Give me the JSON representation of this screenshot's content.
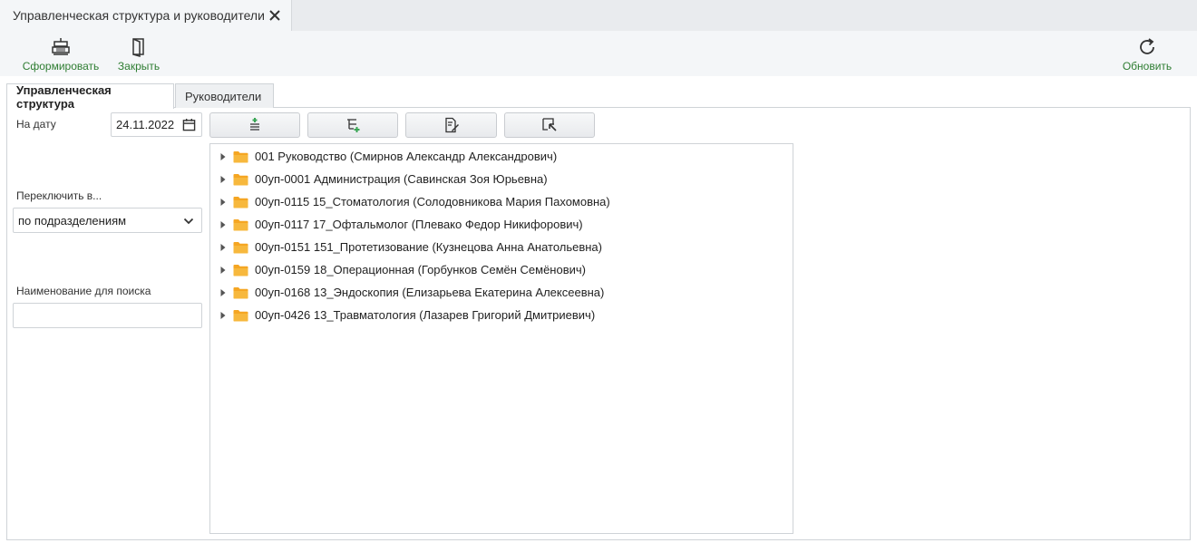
{
  "window_tab": {
    "title": "Управленческая структура и руководители"
  },
  "toolbar": {
    "form_label": "Сформировать",
    "close_label": "Закрыть",
    "refresh_label": "Обновить"
  },
  "tabs": [
    {
      "label": "Управленческая структура",
      "active": true
    },
    {
      "label": "Руководители",
      "active": false
    }
  ],
  "filters": {
    "date_label": "На дату",
    "date_value": "24.11.2022",
    "switch_label": "Переключить в...",
    "switch_value": "по подразделениям",
    "search_label": "Наименование для поиска",
    "search_value": ""
  },
  "tree": {
    "items": [
      {
        "label": "001 Руководство (Смирнов Александр Александрович)"
      },
      {
        "label": "00уп-0001 Администрация (Савинская Зоя Юрьевна)"
      },
      {
        "label": "00уп-0115 15_Стоматология (Солодовникова Мария Пахомовна)"
      },
      {
        "label": "00уп-0117 17_Офтальмолог (Плевако Федор Никифорович)"
      },
      {
        "label": "00уп-0151 151_Протетизование (Кузнецова Анна Анатольевна)"
      },
      {
        "label": "00уп-0159 18_Операционная (Горбунков Семён Семёнович)"
      },
      {
        "label": "00уп-0168 13_Эндоскопия (Елизарьева Екатерина Алексеевна)"
      },
      {
        "label": "00уп-0426 13_Травматология (Лазарев Григорий Дмитриевич)"
      }
    ]
  },
  "colors": {
    "toolbar_label": "#2e7d32",
    "folder": "#f5a623",
    "accent_green": "#3aa655"
  }
}
